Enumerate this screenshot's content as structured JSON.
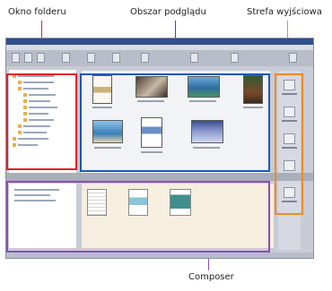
{
  "callouts": {
    "folder_window": "Okno folderu",
    "preview_area": "Obszar podglądu",
    "output_zone": "Strefa wyjściowa",
    "composer": "Composer"
  },
  "colors": {
    "folder_highlight": "#e02424",
    "preview_highlight": "#1f56b5",
    "output_highlight": "#ef8a1d",
    "composer_highlight": "#8a4fb4"
  },
  "icons": {
    "toolbar": [
      "back-icon",
      "forward-icon",
      "up-icon",
      "refresh-icon",
      "print-icon",
      "view-icon",
      "settings-icon",
      "save-icon",
      "export-icon",
      "help-icon"
    ],
    "output": [
      "print-icon",
      "email-icon",
      "web-icon",
      "disk-icon",
      "slideshow-icon"
    ]
  }
}
